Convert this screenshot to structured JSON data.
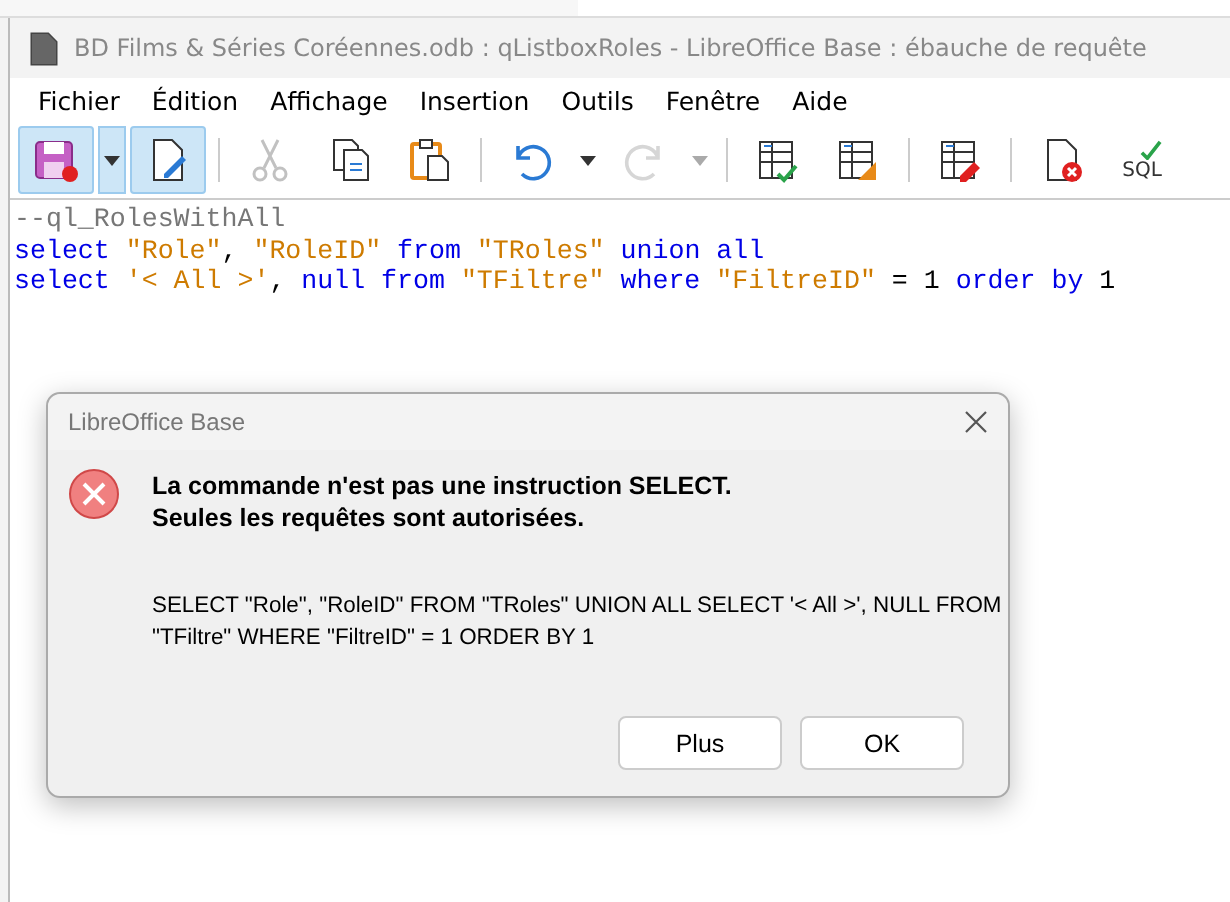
{
  "window": {
    "title": "BD Films & Séries Coréennes.odb : qListboxRoles - LibreOffice Base : ébauche de requête"
  },
  "menu": [
    "Fichier",
    "Édition",
    "Affichage",
    "Insertion",
    "Outils",
    "Fenêtre",
    "Aide"
  ],
  "toolbar": {
    "groups": [
      [
        {
          "selected": true,
          "disabled": false,
          "dropdown": true
        },
        {
          "selected": true,
          "disabled": false
        }
      ],
      [
        {
          "selected": false,
          "disabled": true
        },
        {
          "selected": false,
          "disabled": false
        },
        {
          "selected": false,
          "disabled": false
        }
      ],
      [
        {
          "selected": false,
          "disabled": false,
          "dropdown": true
        },
        {
          "selected": false,
          "disabled": true,
          "dropdown": true
        }
      ],
      [
        {
          "selected": false,
          "disabled": false
        },
        {
          "selected": false,
          "disabled": false
        }
      ],
      [
        {
          "selected": false,
          "disabled": false
        }
      ],
      [
        {
          "selected": false,
          "disabled": false
        },
        {
          "selected": false,
          "disabled": false,
          "label": "SQL"
        }
      ]
    ]
  },
  "editor": {
    "lines": [
      [
        {
          "kind": "comment",
          "text": "--ql_RolesWithAll"
        }
      ],
      [
        {
          "kind": "keyword",
          "text": "select "
        },
        {
          "kind": "string",
          "text": "\"Role\""
        },
        {
          "kind": "plain",
          "text": ", "
        },
        {
          "kind": "string",
          "text": "\"RoleID\" "
        },
        {
          "kind": "keyword",
          "text": "from "
        },
        {
          "kind": "string",
          "text": "\"TRoles\" "
        },
        {
          "kind": "keyword",
          "text": "union all"
        }
      ],
      [
        {
          "kind": "keyword",
          "text": "select "
        },
        {
          "kind": "string",
          "text": "'< All >'"
        },
        {
          "kind": "plain",
          "text": ", "
        },
        {
          "kind": "keyword",
          "text": "null from "
        },
        {
          "kind": "string",
          "text": "\"TFiltre\" "
        },
        {
          "kind": "keyword",
          "text": "where "
        },
        {
          "kind": "string",
          "text": "\"FiltreID\""
        },
        {
          "kind": "plain",
          "text": " = 1 "
        },
        {
          "kind": "keyword",
          "text": "order by "
        },
        {
          "kind": "plain",
          "text": "1"
        }
      ]
    ]
  },
  "dialog": {
    "title": "LibreOffice Base",
    "message": [
      "La commande n'est pas une instruction SELECT.",
      "Seules les requêtes sont autorisées."
    ],
    "detail": "SELECT \"Role\", \"RoleID\" FROM \"TRoles\" UNION ALL SELECT '< All >', NULL FROM \"TFiltre\" WHERE \"FiltreID\" = 1 ORDER BY 1",
    "buttons": [
      "Plus",
      "OK"
    ]
  }
}
